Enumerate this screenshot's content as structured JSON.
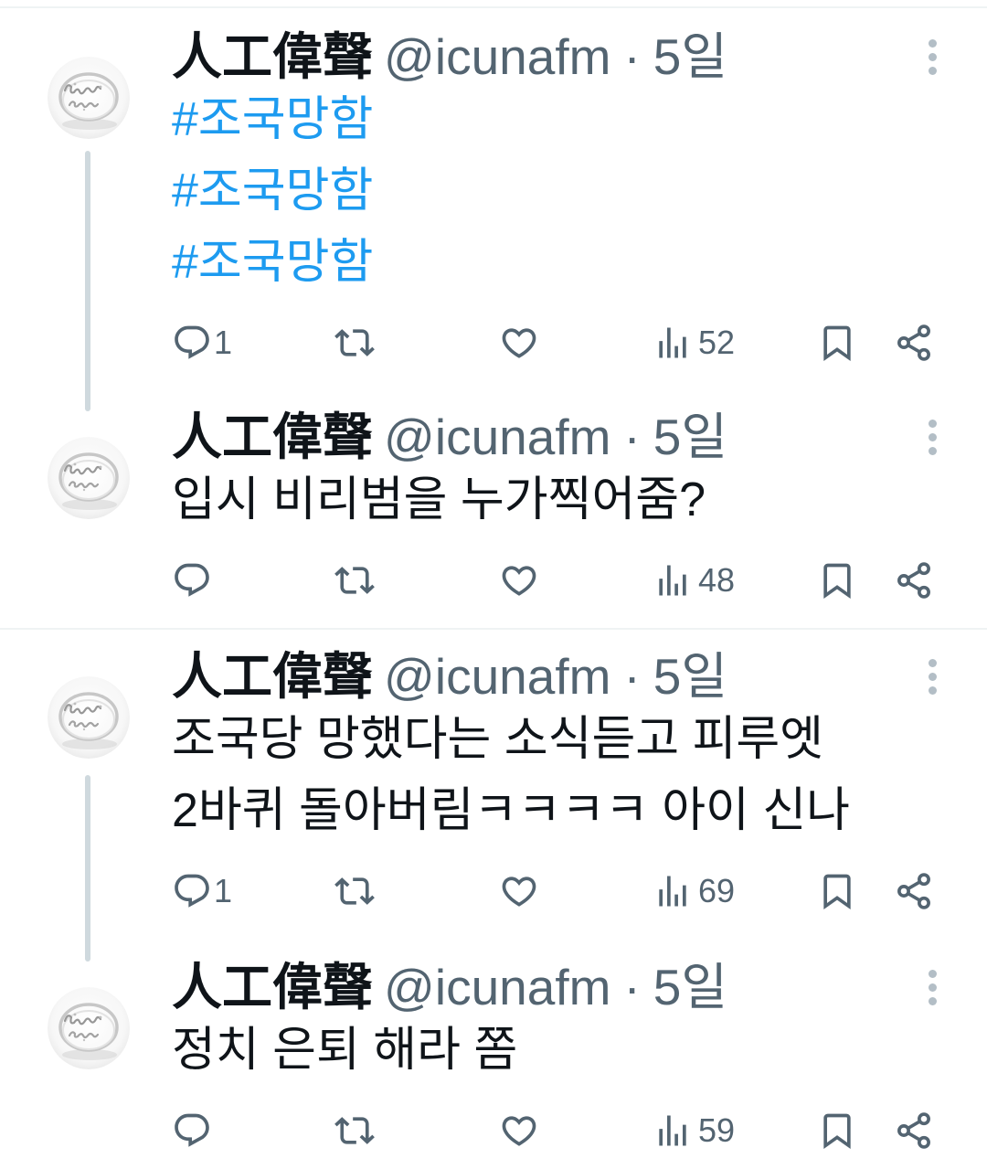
{
  "colors": {
    "text": "#0f1419",
    "secondary": "#536471",
    "link": "#1d9bf0",
    "thread_line": "#cfd9de",
    "divider": "#eff3f4",
    "more_icon": "#b3bec6"
  },
  "icons": {
    "avatar": "ring-photo-avatar",
    "more": "more-vertical-icon",
    "reply": "reply-icon",
    "retweet": "retweet-icon",
    "like": "heart-icon",
    "views": "views-bar-chart-icon",
    "bookmark": "bookmark-icon",
    "share": "share-icon"
  },
  "tweets": [
    {
      "author": {
        "name": "人工偉聲",
        "handle": "@icunafm"
      },
      "separator": "·",
      "time": "5일",
      "hashtags": [
        "#조국망함",
        "#조국망함",
        "#조국망함"
      ],
      "stats": {
        "replies": 1,
        "views": 52
      },
      "thread_continues": true
    },
    {
      "author": {
        "name": "人工偉聲",
        "handle": "@icunafm"
      },
      "separator": "·",
      "time": "5일",
      "text_lines": [
        "입시 비리범을 누가찍어줌?"
      ],
      "stats": {
        "views": 48
      },
      "thread_continues": false
    },
    {
      "author": {
        "name": "人工偉聲",
        "handle": "@icunafm"
      },
      "separator": "·",
      "time": "5일",
      "text_lines": [
        "조국당 망했다는 소식듣고 피루엣",
        "2바퀴 돌아버림ㅋㅋㅋㅋ 아이 신나"
      ],
      "stats": {
        "replies": 1,
        "views": 69
      },
      "thread_continues": true
    },
    {
      "author": {
        "name": "人工偉聲",
        "handle": "@icunafm"
      },
      "separator": "·",
      "time": "5일",
      "text_lines": [
        "정치 은퇴 해라 쫌"
      ],
      "stats": {
        "views": 59
      },
      "thread_continues": false
    }
  ]
}
